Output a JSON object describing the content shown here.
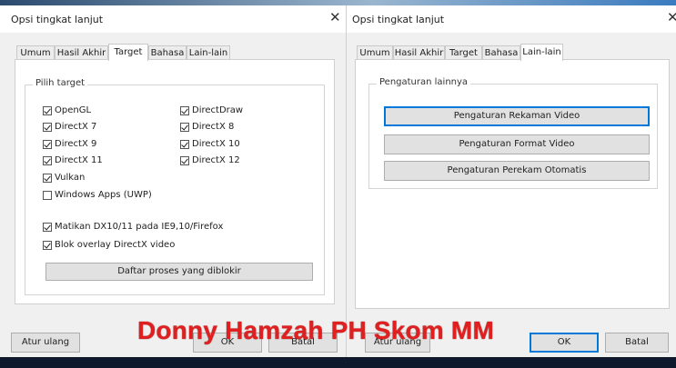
{
  "left_dialog": {
    "title": "Opsi tingkat lanjut",
    "close_glyph": "✕",
    "tabs": [
      {
        "label": "Umum",
        "active": false
      },
      {
        "label": "Hasil Akhir",
        "active": false
      },
      {
        "label": "Target",
        "active": true
      },
      {
        "label": "Bahasa",
        "active": false
      },
      {
        "label": "Lain-lain",
        "active": false
      }
    ],
    "group_title": "Pilih target",
    "checkboxes": [
      {
        "label": "OpenGL",
        "checked": true
      },
      {
        "label": "DirectDraw",
        "checked": true
      },
      {
        "label": "DirectX 7",
        "checked": true
      },
      {
        "label": "DirectX 8",
        "checked": true
      },
      {
        "label": "DirectX 9",
        "checked": true
      },
      {
        "label": "DirectX 10",
        "checked": true
      },
      {
        "label": "DirectX 11",
        "checked": true
      },
      {
        "label": "DirectX 12",
        "checked": true
      },
      {
        "label": "Vulkan",
        "checked": true
      },
      {
        "label": "Windows Apps (UWP)",
        "checked": false
      }
    ],
    "options": [
      {
        "label": "Matikan DX10/11 pada IE9,10/Firefox",
        "checked": true
      },
      {
        "label": "Blok overlay DirectX video",
        "checked": true
      }
    ],
    "blocked_button": "Daftar proses yang diblokir",
    "reset_button": "Atur ulang",
    "ok_button": "OK",
    "cancel_button": "Batal"
  },
  "right_dialog": {
    "title": "Opsi tingkat lanjut",
    "close_glyph": "✕",
    "tabs": [
      {
        "label": "Umum",
        "active": false
      },
      {
        "label": "Hasil Akhir",
        "active": false
      },
      {
        "label": "Target",
        "active": false
      },
      {
        "label": "Bahasa",
        "active": false
      },
      {
        "label": "Lain-lain",
        "active": true
      }
    ],
    "group_title": "Pengaturan lainnya",
    "buttons": [
      "Pengaturan Rekaman Video",
      "Pengaturan Format Video",
      "Pengaturan Perekam Otomatis"
    ],
    "reset_button": "Atur ulang",
    "ok_button": "OK",
    "cancel_button": "Batal"
  },
  "watermark": "Donny Hamzah PH Skom MM"
}
